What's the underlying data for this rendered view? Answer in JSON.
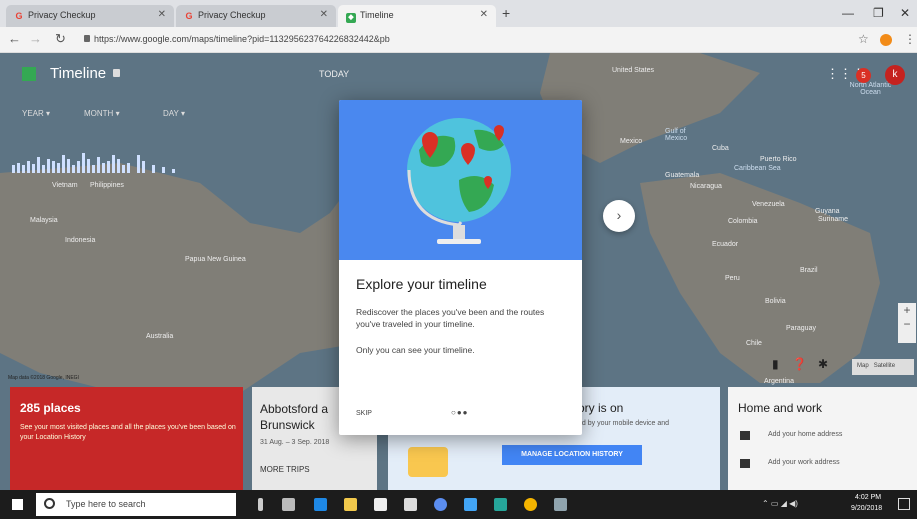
{
  "browser": {
    "tabs": [
      {
        "title": "Privacy Checkup",
        "favicon": "google-icon"
      },
      {
        "title": "Privacy Checkup",
        "favicon": "google-icon"
      },
      {
        "title": "Timeline",
        "favicon": "google-maps-icon"
      }
    ],
    "new_tab_label": "+",
    "url": "https://www.google.com/maps/timeline?pid=113295623764226832442&pb"
  },
  "timeline_panel": {
    "title": "Timeline",
    "today_label": "TODAY",
    "year_label": "YEAR",
    "month_label": "MONTH",
    "day_label": "DAY"
  },
  "map": {
    "footer": "Map data ©2018 Google, INEGI",
    "map_label": "Map",
    "satellite_label": "Satellite",
    "labels": [
      "United States",
      "Mexico",
      "Cuba",
      "Puerto Rico",
      "Venezuela",
      "Colombia",
      "Ecuador",
      "Peru",
      "Brazil",
      "Bolivia",
      "Paraguay",
      "Chile",
      "Argentina",
      "North Atlantic Ocean",
      "Malaysia",
      "Indonesia",
      "Papua New Guinea",
      "Australia",
      "Philippines",
      "Vietnam",
      "Guyana",
      "Suriname",
      "Guatemala",
      "Nicaragua",
      "Gulf of Mexico",
      "Caribbean Sea"
    ]
  },
  "header_account": {
    "notification_count": "5",
    "avatar_letter": "k"
  },
  "cards": {
    "places": {
      "title": "285 places",
      "description": "See your most visited places and all the places you've been based on your Location History"
    },
    "trip": {
      "title": "Abbotsford a Brunswick",
      "dates": "31 Aug. – 3 Sep. 2018",
      "more": "MORE TRIPS"
    },
    "history": {
      "title": "ory is on",
      "subtitle": "ed by your mobile device and",
      "button": "MANAGE LOCATION HISTORY"
    },
    "home_work": {
      "title": "Home and work",
      "home_address": "Add your home address",
      "work_address": "Add your work address"
    }
  },
  "dialog": {
    "title": "Explore your timeline",
    "body": "Rediscover the places you've been and the routes you've traveled in your timeline.",
    "note": "Only you can see your timeline.",
    "skip": "SKIP",
    "page_dots": "○●●",
    "hero_color": "#4a88ef"
  },
  "taskbar": {
    "search_placeholder": "Type here to search",
    "time": "4:02 PM",
    "date": "9/20/2018"
  }
}
